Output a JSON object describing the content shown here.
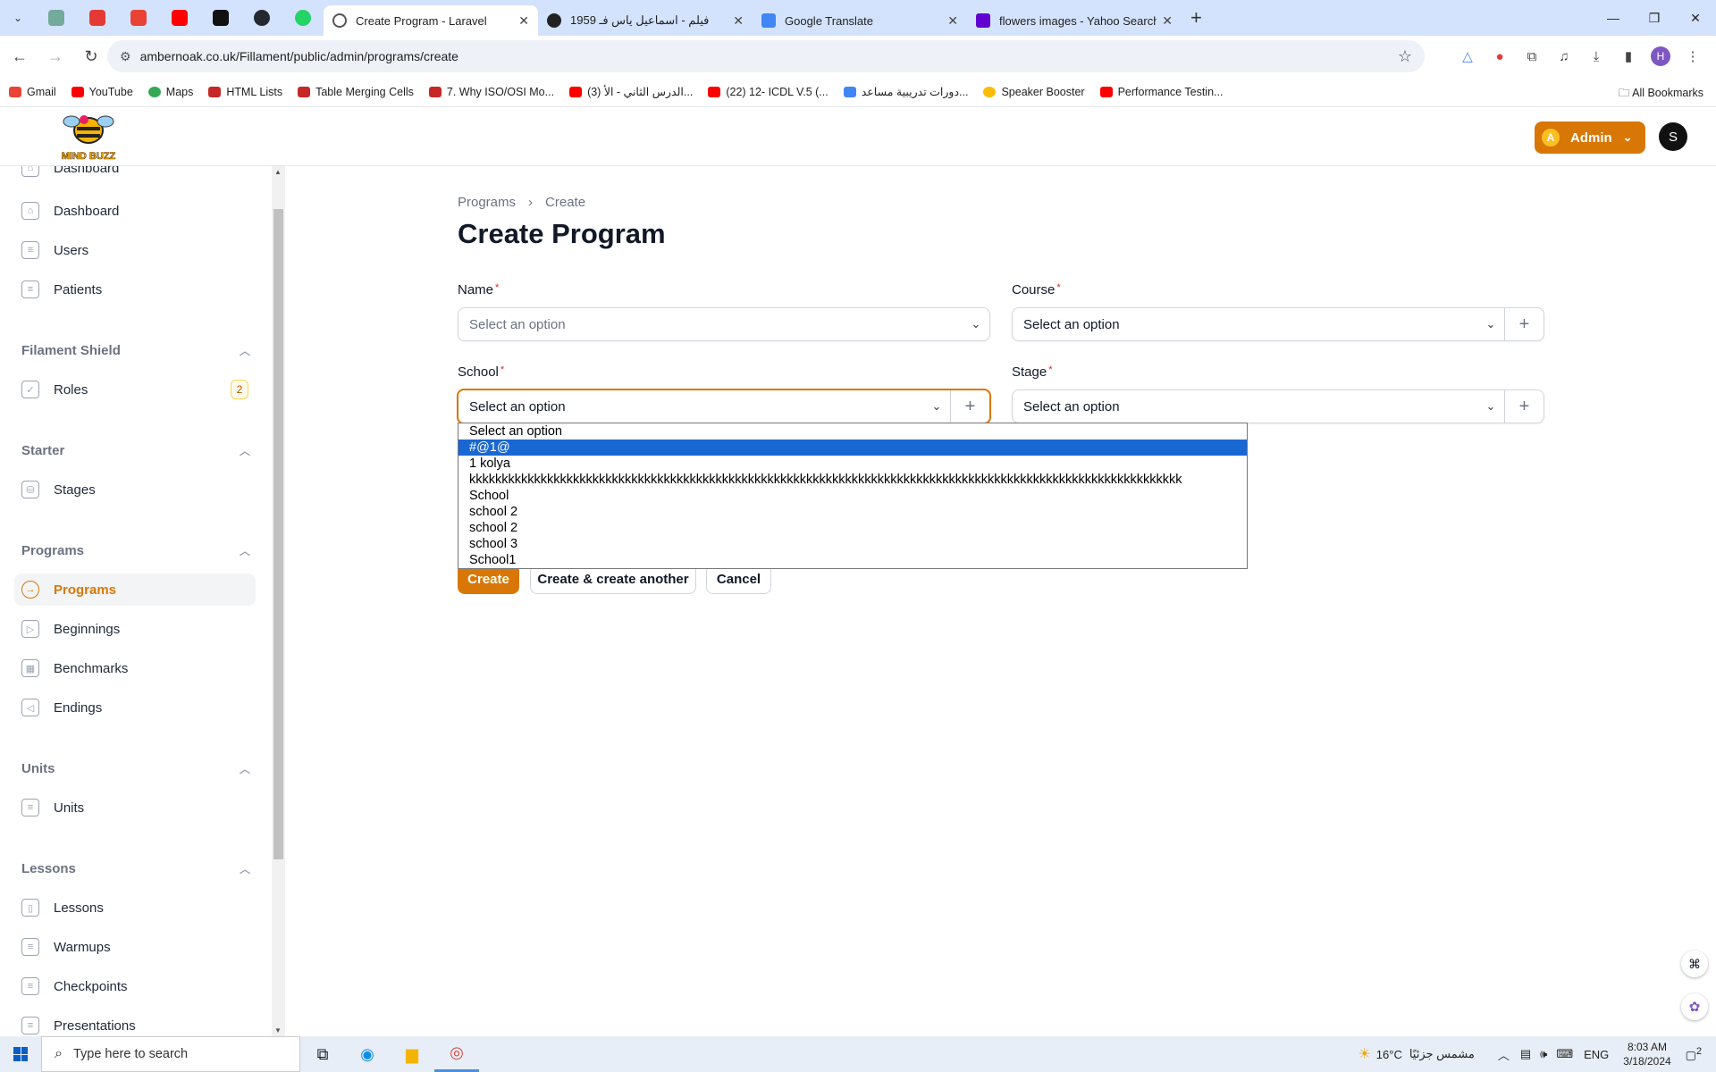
{
  "browser": {
    "tabs": [
      {
        "title": "Create Program - Laravel",
        "active": true,
        "color": "#555555"
      },
      {
        "title": "1959 فيلم - اسماعيل ياس فـ",
        "active": false,
        "color": "#222222"
      },
      {
        "title": "Google Translate",
        "active": false,
        "color": "#4285f4"
      },
      {
        "title": "flowers images - Yahoo Search",
        "active": false,
        "color": "#6001d2"
      }
    ],
    "url": "ambernoak.co.uk/Fillament/public/admin/programs/create",
    "bookmarks": [
      {
        "label": "Gmail",
        "color": "#ea4335"
      },
      {
        "label": "YouTube",
        "color": "#ff0000"
      },
      {
        "label": "Maps",
        "color": "#34a853"
      },
      {
        "label": "HTML Lists",
        "color": "#c62828"
      },
      {
        "label": "Table Merging Cells",
        "color": "#c62828"
      },
      {
        "label": "7. Why ISO/OSI Mo...",
        "color": "#c62828"
      },
      {
        "label": "(3) الدرس الثاني - الأ...",
        "color": "#ff0000"
      },
      {
        "label": "(22) 12- ICDL V.5 (...",
        "color": "#ff0000"
      },
      {
        "label": "دورات تدريبية مساعد...",
        "color": "#4285f4"
      },
      {
        "label": "Speaker Booster",
        "color": "#fbbc05"
      },
      {
        "label": "Performance Testin...",
        "color": "#ff0000"
      }
    ],
    "all_bookmarks": "All Bookmarks",
    "profile_initial": "H"
  },
  "header": {
    "logo_text": "MIND BUZZ",
    "admin_label": "Admin",
    "admin_initial": "A",
    "user_initial": "S"
  },
  "sidebar": {
    "partial_item": "Dashboard",
    "items": [
      {
        "label": "Dashboard",
        "icon": "home-icon"
      },
      {
        "label": "Users",
        "icon": "stack-icon"
      },
      {
        "label": "Patients",
        "icon": "stack-icon"
      }
    ],
    "groups": [
      {
        "label": "Filament Shield",
        "items": [
          {
            "label": "Roles",
            "icon": "shield-icon",
            "badge": "2"
          }
        ]
      },
      {
        "label": "Starter",
        "items": [
          {
            "label": "Stages",
            "icon": "database-icon"
          }
        ]
      },
      {
        "label": "Programs",
        "items": [
          {
            "label": "Programs",
            "icon": "arrow-circle-icon",
            "active": true
          },
          {
            "label": "Beginnings",
            "icon": "forward-icon"
          },
          {
            "label": "Benchmarks",
            "icon": "film-icon"
          },
          {
            "label": "Endings",
            "icon": "backward-icon"
          }
        ]
      },
      {
        "label": "Units",
        "items": [
          {
            "label": "Units",
            "icon": "stack-icon"
          }
        ]
      },
      {
        "label": "Lessons",
        "items": [
          {
            "label": "Lessons",
            "icon": "book-icon"
          },
          {
            "label": "Warmups",
            "icon": "stack-icon"
          },
          {
            "label": "Checkpoints",
            "icon": "stack-icon"
          },
          {
            "label": "Presentations",
            "icon": "stack-icon"
          }
        ]
      }
    ]
  },
  "main": {
    "breadcrumb": [
      "Programs",
      "Create"
    ],
    "title": "Create Program",
    "fields": {
      "name": {
        "label": "Name",
        "value": "Select an option"
      },
      "course": {
        "label": "Course",
        "value": "Select an option"
      },
      "school": {
        "label": "School",
        "value": "Select an option"
      },
      "stage": {
        "label": "Stage",
        "value": "Select an option"
      }
    },
    "school_options": [
      "Select an option",
      "#@1@",
      "1 kolya",
      "kkkkkkkkkkkkkkkkkkkkkkkkkkkkkkkkkkkkkkkkkkkkkkkkkkkkkkkkkkkkkkkkkkkkkkkkkkkkkkkkkkkkkkkkkkkkkkkkkkkkkkkkkkkkkk",
      "School",
      "school 2",
      "school 2",
      "school 3",
      "School1"
    ],
    "school_highlighted_index": 1,
    "buttons": {
      "create": "Create",
      "create_another": "Create & create another",
      "cancel": "Cancel"
    }
  },
  "taskbar": {
    "search_placeholder": "Type here to search",
    "weather": "16°C",
    "weather_text": "مشمس جزئيًا",
    "lang": "ENG",
    "time": "8:03 AM",
    "date": "3/18/2024",
    "notifications": "2"
  },
  "colors": {
    "accent": "#d97706",
    "selection": "#1967d2"
  }
}
